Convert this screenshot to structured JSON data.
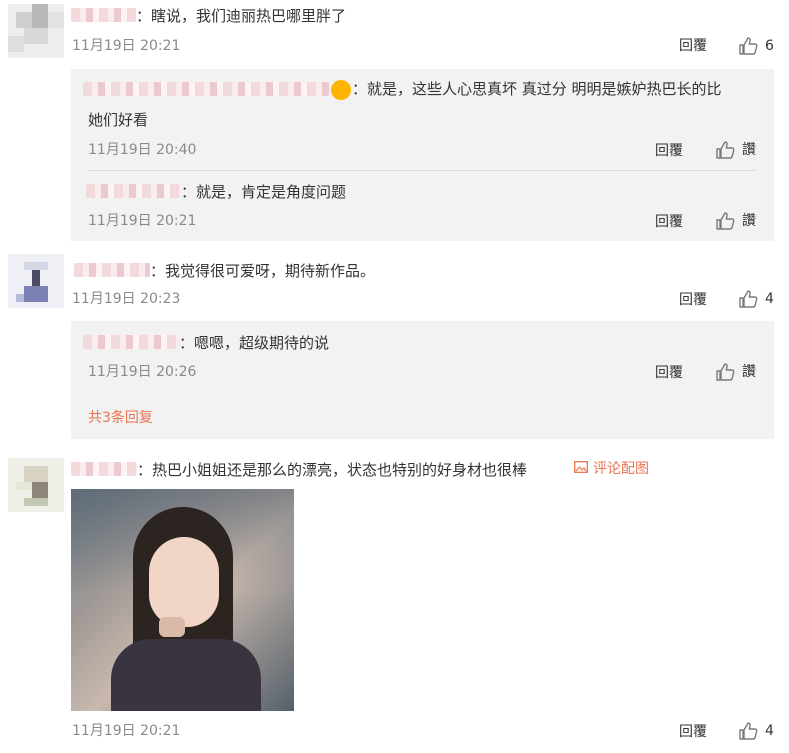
{
  "colors": {
    "accent": "#eb7350",
    "meta": "#8a8a8a",
    "text": "#333333",
    "reply_bg": "#f2f2f2"
  },
  "labels": {
    "reply": "回覆",
    "like": "讚"
  },
  "comments": [
    {
      "text": "：瞎说，我们迪丽热巴哪里胖了",
      "time": "11月19日 20:21",
      "likes": "6",
      "replies": [
        {
          "text_line1": "：就是，这些人心思真坏 真过分 明明是嫉妒热巴长的比",
          "text_line2": "她们好看",
          "time": "11月19日 20:40",
          "has_emoji": true
        },
        {
          "text_line1": "：就是，肯定是角度问题",
          "time": "11月19日 20:21"
        }
      ]
    },
    {
      "text": "：我觉得很可爱呀，期待新作品。",
      "time": "11月19日 20:23",
      "likes": "4",
      "replies": [
        {
          "text_line1": "：嗯嗯，超级期待的说",
          "time": "11月19日 20:26"
        }
      ],
      "more_replies": "共3条回复"
    },
    {
      "text": "：热巴小姐姐还是那么的漂亮，状态也特别的好身材也很棒",
      "image_link": "评论配图",
      "time": "11月19日 20:21",
      "likes": "4"
    }
  ]
}
